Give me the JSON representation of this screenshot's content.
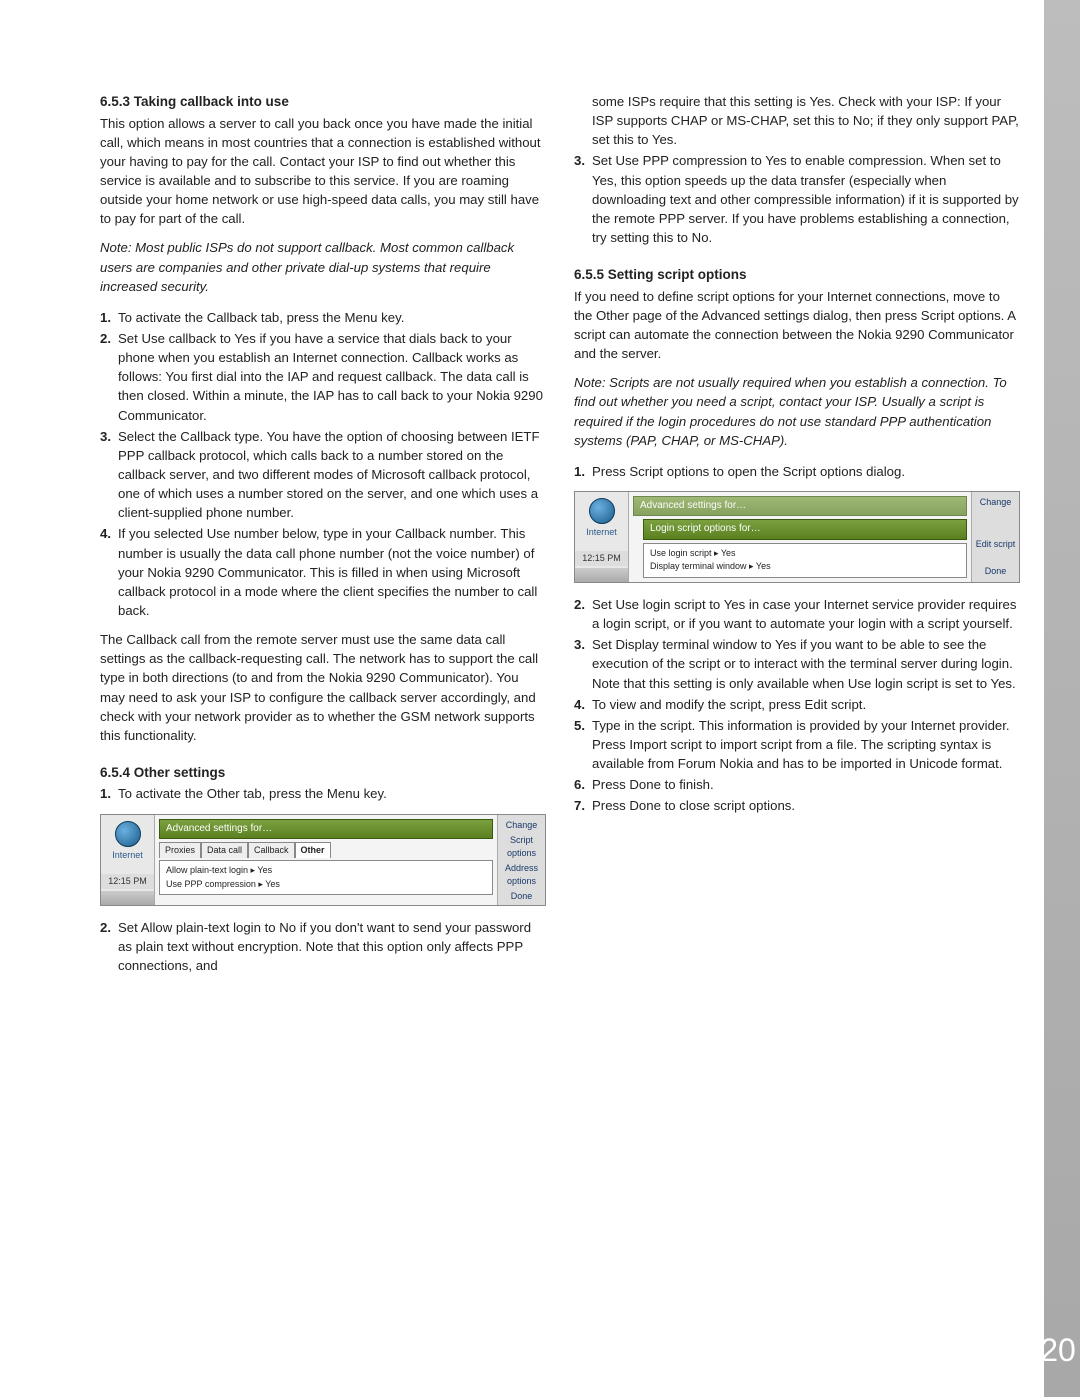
{
  "pageNumber": "20",
  "left": {
    "s1_title": "6.5.3 Taking callback into use",
    "s1_para": "This option allows a server to call you back once you have made the initial call, which means in most countries that a connection is established without your having to pay for the call. Contact your ISP to find out whether this service is available and to subscribe to this service. If you are roaming outside your home network or use high-speed data calls, you may still have to pay for part of the call.",
    "s1_note": "Note: Most public ISPs do not support callback. Most common callback users are companies and other private dial-up systems that require increased security.",
    "s1_items": {
      "n1": "1.",
      "t1": "To activate the Callback tab, press the Menu key.",
      "n2": "2.",
      "t2": "Set Use callback to Yes if you have a service that dials back to your phone when you establish an Internet connection. Callback works as follows: You first dial into the IAP and request callback. The data call is then closed. Within a minute, the IAP has to call back to your Nokia 9290 Communicator.",
      "n3": "3.",
      "t3": "Select the Callback type. You have the option of choosing between IETF PPP callback protocol, which calls back to a number stored on the callback server, and two different modes of Microsoft callback protocol, one of which uses a number stored on the server, and one which uses a client-supplied phone number.",
      "n4": "4.",
      "t4": "If you selected Use number below, type in your Callback number. This number is usually the data call phone number (not the voice number) of your Nokia 9290 Communicator. This is filled in when using Microsoft callback protocol in a mode where the client specifies the number to call back."
    },
    "s1_para2": "The Callback call from the remote server must use the same data call settings as the callback-requesting call. The network has to support the call type in both directions (to and from the Nokia 9290 Communicator). You may need to ask your ISP to configure the callback server accordingly, and check with your network provider as to whether the GSM network supports this functionality.",
    "s2_title": "6.5.4 Other settings",
    "s2_intro_n": "1.",
    "s2_intro_t": "To activate the Other tab, press the Menu key.",
    "shot1": {
      "leftLabel": "Internet",
      "time": "12:15 PM",
      "title": "Advanced settings for…",
      "tabs": [
        "Proxies",
        "Data call",
        "Callback",
        "Other"
      ],
      "line1": "Allow plain-text login  ▸  Yes",
      "line2": "Use PPP compression  ▸  Yes",
      "btn1": "Change",
      "btn2": "Script options",
      "btn3": "Address options",
      "btn4": "Done"
    },
    "s2_items": {
      "n2": "2.",
      "t2": "Set Allow plain-text login to No if you don't want to send your password as plain text without encryption. Note that this option only affects PPP connections, and"
    }
  },
  "right": {
    "cont1": "some ISPs require that this setting is Yes. Check with your ISP: If your ISP supports CHAP or MS-CHAP, set this to No; if they only support PAP, set this to Yes.",
    "cont_n3": "3.",
    "cont_t3": "Set Use PPP compression to Yes to enable compression. When set to Yes, this option speeds up the data transfer (especially when downloading text and other compressible information) if it is supported by the remote PPP server. If you have problems establishing a connection, try setting this to No.",
    "s3_title": "6.5.5 Setting script options",
    "s3_para": "If you need to define script options for your Internet connections, move to the Other page of the Advanced settings dialog, then press Script options. A script can automate the connection between the Nokia 9290 Communicator and the server.",
    "s3_note": "Note: Scripts are not usually required when you establish a connection. To find out whether you need a script, contact your ISP. Usually a script is required if the login procedures do not use standard PPP authentication systems (PAP, CHAP, or MS-CHAP).",
    "s3_items": {
      "n1": "1.",
      "t1": "Press Script options to open the Script options dialog."
    },
    "shot2": {
      "leftLabel": "Internet",
      "time": "12:15 PM",
      "title1": "Advanced settings for…",
      "title2": "Login script options for…",
      "line1": "Use login script  ▸  Yes",
      "line2": "Display terminal window  ▸  Yes",
      "btn1": "Change",
      "btn2": "Edit script",
      "btn3": "Done"
    },
    "s3_items2": {
      "n2": "2.",
      "t2": "Set Use login script to Yes in case your Internet service provider requires a login script, or if you want to automate your login with a script yourself.",
      "n3": "3.",
      "t3": "Set Display terminal window to Yes if you want to be able to see the execution of the script or to interact with the terminal server during login. Note that this setting is only available when Use login script is set to Yes.",
      "n4": "4.",
      "t4": "To view and modify the script, press Edit script.",
      "n5": "5.",
      "t5": "Type in the script. This information is provided by your Internet provider. Press Import script to import script from a file. The scripting syntax is available from Forum Nokia and has to be imported in Unicode format.",
      "n6": "6.",
      "t6": "Press Done to finish.",
      "n7": "7.",
      "t7": "Press Done to close script options."
    }
  }
}
